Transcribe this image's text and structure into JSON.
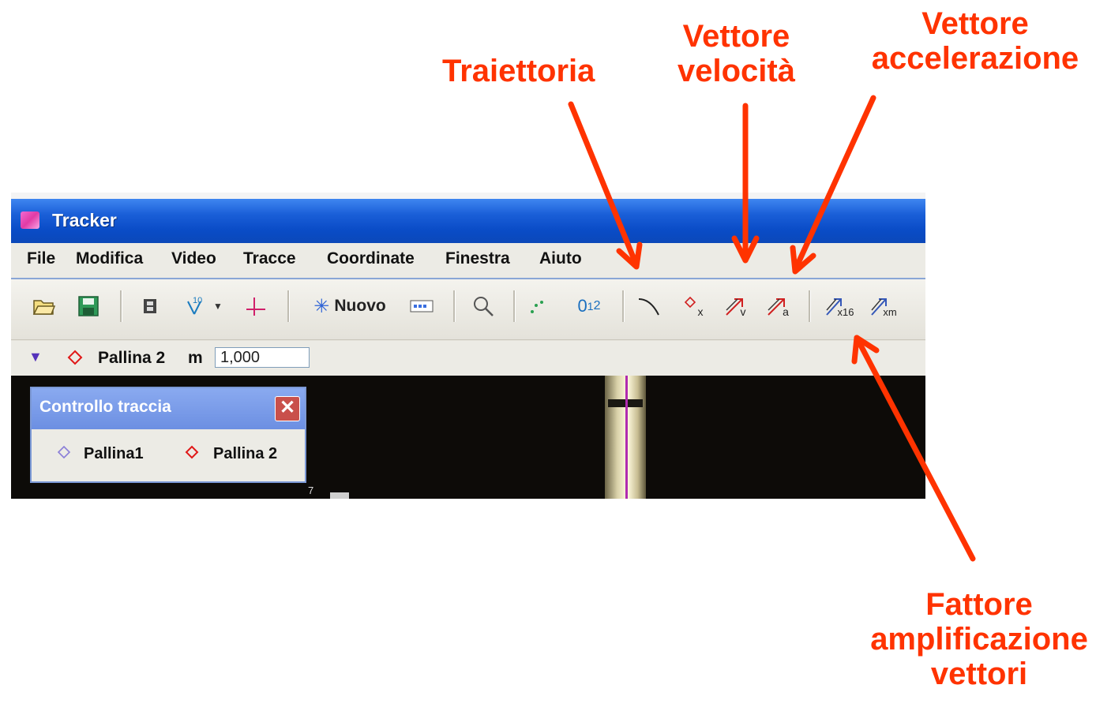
{
  "annotations": {
    "traiettoria": "Traiettoria",
    "vettore_velocita": [
      "Vettore",
      "velocità"
    ],
    "vettore_accelerazione": [
      "Vettore",
      "accelerazione"
    ],
    "fattore_amplificazione": [
      "Fattore",
      "amplificazione",
      "vettori"
    ]
  },
  "window": {
    "title": "Tracker"
  },
  "menu": {
    "items": [
      "File",
      "Modifica",
      "Video",
      "Tracce",
      "Coordinate",
      "Finestra",
      "Aiuto"
    ]
  },
  "toolbar": {
    "new_label": "Nuovo",
    "counter_label": "0",
    "counter_sup": "1",
    "counter_sub": "2",
    "calibration_label": "10",
    "vector_velocity_sub": "v",
    "vector_accel_sub": "a",
    "vector_scale_sub": "x16",
    "vector_mass_sub": "xm",
    "position_sub": "x"
  },
  "trackbar": {
    "track_name": "Pallina 2",
    "mass_label": "m",
    "mass_value": "1,000"
  },
  "track_control": {
    "title": "Controllo traccia",
    "close_glyph": "✕",
    "tracks": [
      "Pallina1",
      "Pallina 2"
    ]
  },
  "colors": {
    "annotation": "#ff3300",
    "title_bar": "#0a4cc7",
    "track1_marker": "#8a7ed8",
    "track2_marker": "#e01818"
  },
  "video": {
    "axis_label": "7"
  }
}
